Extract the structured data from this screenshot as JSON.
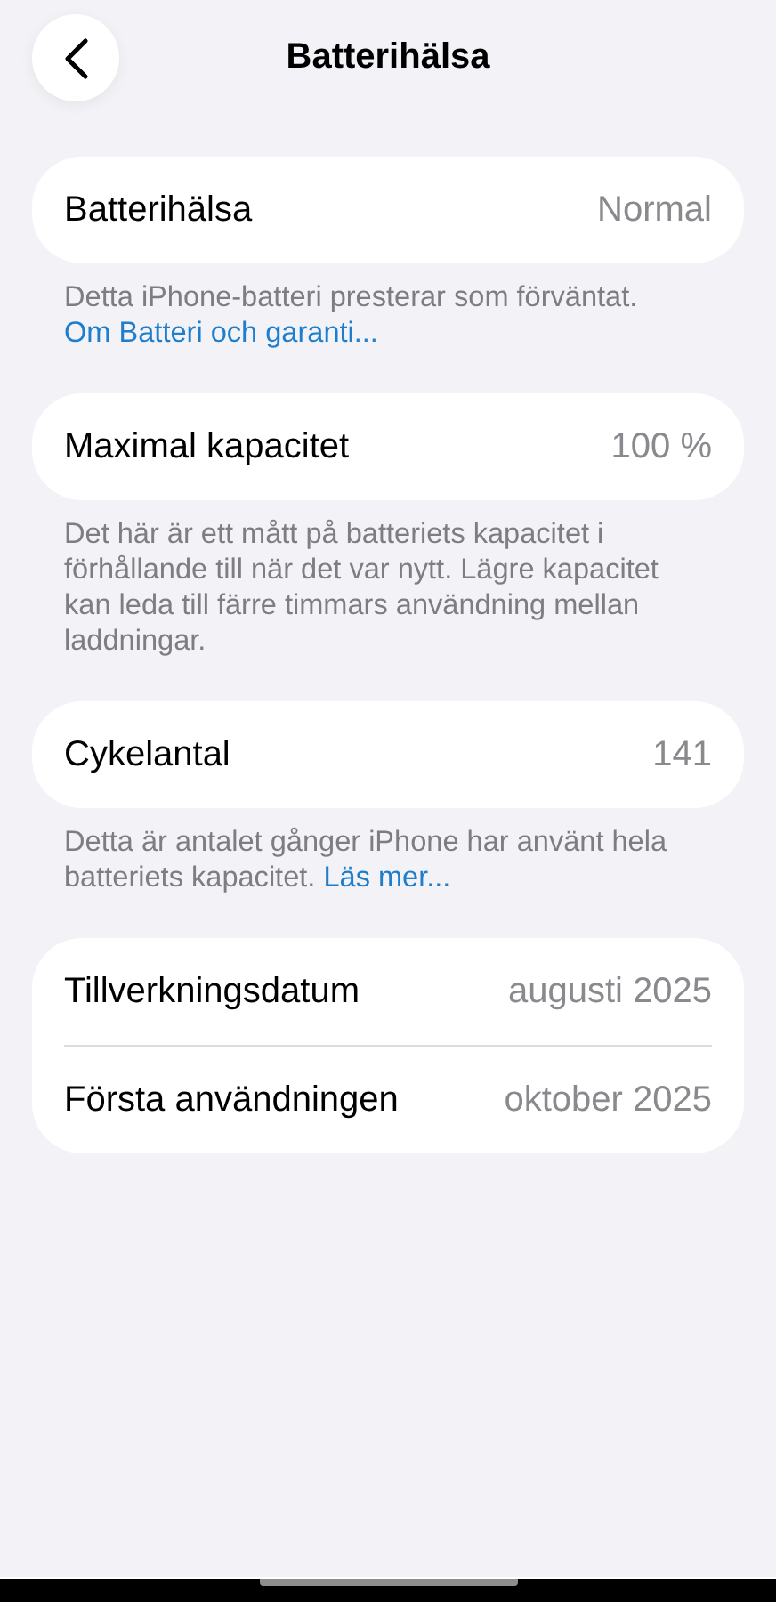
{
  "nav": {
    "title": "Batterihälsa"
  },
  "sections": [
    {
      "rows": [
        {
          "label": "Batterihälsa",
          "value": "Normal"
        }
      ],
      "footer": {
        "text": "Detta iPhone-batteri presterar som förväntat.",
        "link": "Om Batteri och garanti..."
      }
    },
    {
      "rows": [
        {
          "label": "Maximal kapacitet",
          "value": "100 %"
        }
      ],
      "footer": {
        "text": "Det här är ett mått på batteriets kapacitet i förhållande till när det var nytt. Lägre kapacitet kan leda till färre timmars användning mellan laddningar."
      }
    },
    {
      "rows": [
        {
          "label": "Cykelantal",
          "value": "141"
        }
      ],
      "footer": {
        "text": "Detta är antalet gånger iPhone har använt hela batteriets kapacitet.",
        "link": "Läs mer..."
      }
    },
    {
      "rows": [
        {
          "label": "Tillverkningsdatum",
          "value": "augusti 2025"
        },
        {
          "label": "Första användningen",
          "value": "oktober 2025"
        }
      ]
    }
  ]
}
